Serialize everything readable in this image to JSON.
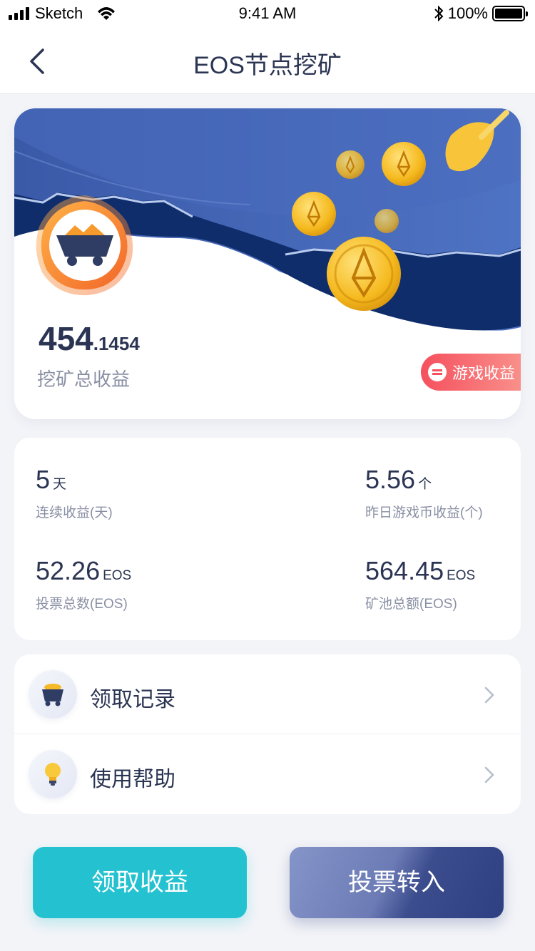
{
  "status_bar": {
    "carrier": "Sketch",
    "time": "9:41 AM",
    "battery": "100%"
  },
  "nav": {
    "title": "EOS节点挖矿",
    "back_icon": "chevron-left-icon"
  },
  "hero": {
    "total_int": "454",
    "total_dec": ".1454",
    "total_label": "挖矿总收益",
    "game_income_label": "游戏收益"
  },
  "stats": {
    "streak": {
      "value": "5",
      "unit": "天",
      "label": "连续收益(天)"
    },
    "yesterday_coins": {
      "value": "5.56",
      "unit": "个",
      "label": "昨日游戏币收益(个)"
    },
    "votes": {
      "value": "52.26",
      "unit": "EOS",
      "label": "投票总数(EOS)"
    },
    "pool": {
      "value": "564.45",
      "unit": "EOS",
      "label": "矿池总额(EOS)"
    }
  },
  "menu": {
    "items": [
      {
        "label": "领取记录",
        "icon": "mine-cart-icon"
      },
      {
        "label": "使用帮助",
        "icon": "lightbulb-icon"
      }
    ]
  },
  "buttons": {
    "claim": "领取收益",
    "vote_in": "投票转入"
  },
  "colors": {
    "primary_text": "#2b3553",
    "claim": "#24c2d0",
    "vote": "#2e3f82",
    "badge": "#f5505e"
  }
}
